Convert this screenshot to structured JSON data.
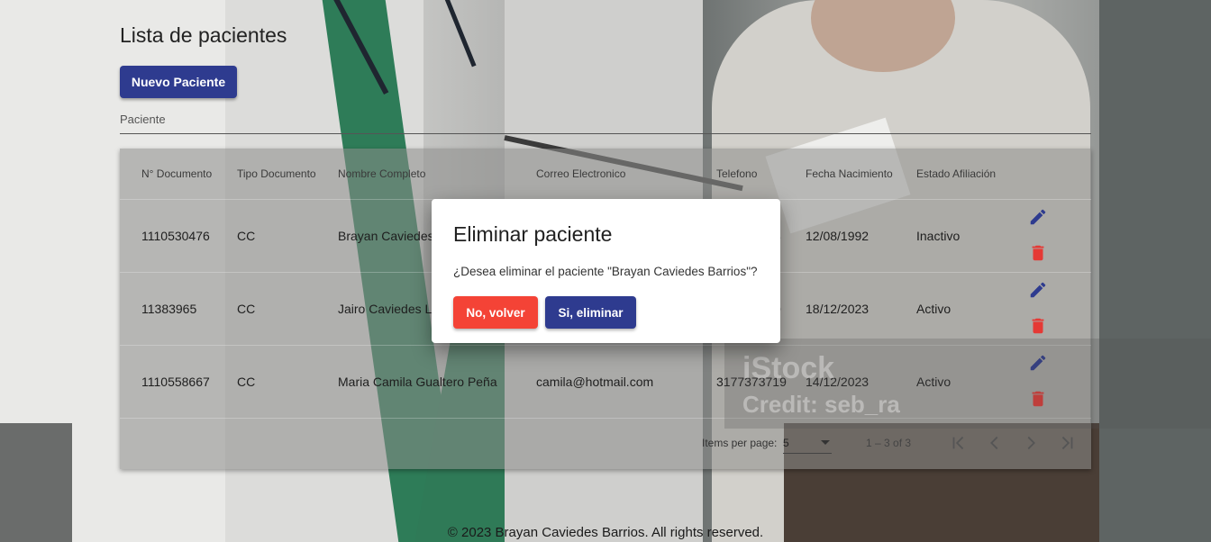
{
  "page": {
    "title": "Lista de pacientes",
    "new_button": "Nuevo Paciente",
    "filter_placeholder": "Paciente"
  },
  "table": {
    "headers": [
      "N° Documento",
      "Tipo Documento",
      "Nombre Completo",
      "Correo Electronico",
      "Telefono",
      "Fecha Nacimiento",
      "Estado Afiliación"
    ],
    "rows": [
      [
        "1110530476",
        "CC",
        "Brayan Caviedes",
        "",
        "8",
        "12/08/1992",
        "Inactivo"
      ],
      [
        "11383965",
        "CC",
        "Jairo Caviedes L",
        "",
        "0",
        "18/12/2023",
        "Activo"
      ],
      [
        "1110558667",
        "CC",
        "Maria Camila Gualtero Peña",
        "camila@hotmail.com",
        "3177373719",
        "14/12/2023",
        "Activo"
      ]
    ]
  },
  "paginator": {
    "items_per_page_label": "Items per page:",
    "page_size": "5",
    "range_label": "1 – 3 of 3"
  },
  "watermark": {
    "brand": "iStock",
    "credit": "Credit: seb_ra"
  },
  "footer": "© 2023 Brayan Caviedes Barrios. All rights reserved.",
  "dialog": {
    "title": "Eliminar paciente",
    "message": "¿Desea eliminar el paciente \"Brayan Caviedes Barrios\"?",
    "cancel_label": "No, volver",
    "confirm_label": "Si, eliminar"
  },
  "colors": {
    "primary": "#2e3b8f",
    "warn": "#f44336",
    "edit_icon": "#2e3b8f",
    "delete_icon": "#e53935"
  },
  "icons": {
    "edit": "pencil-icon",
    "delete": "trash-icon",
    "first_page": "first-page-icon",
    "prev_page": "chevron-left-icon",
    "next_page": "chevron-right-icon",
    "last_page": "last-page-icon"
  }
}
